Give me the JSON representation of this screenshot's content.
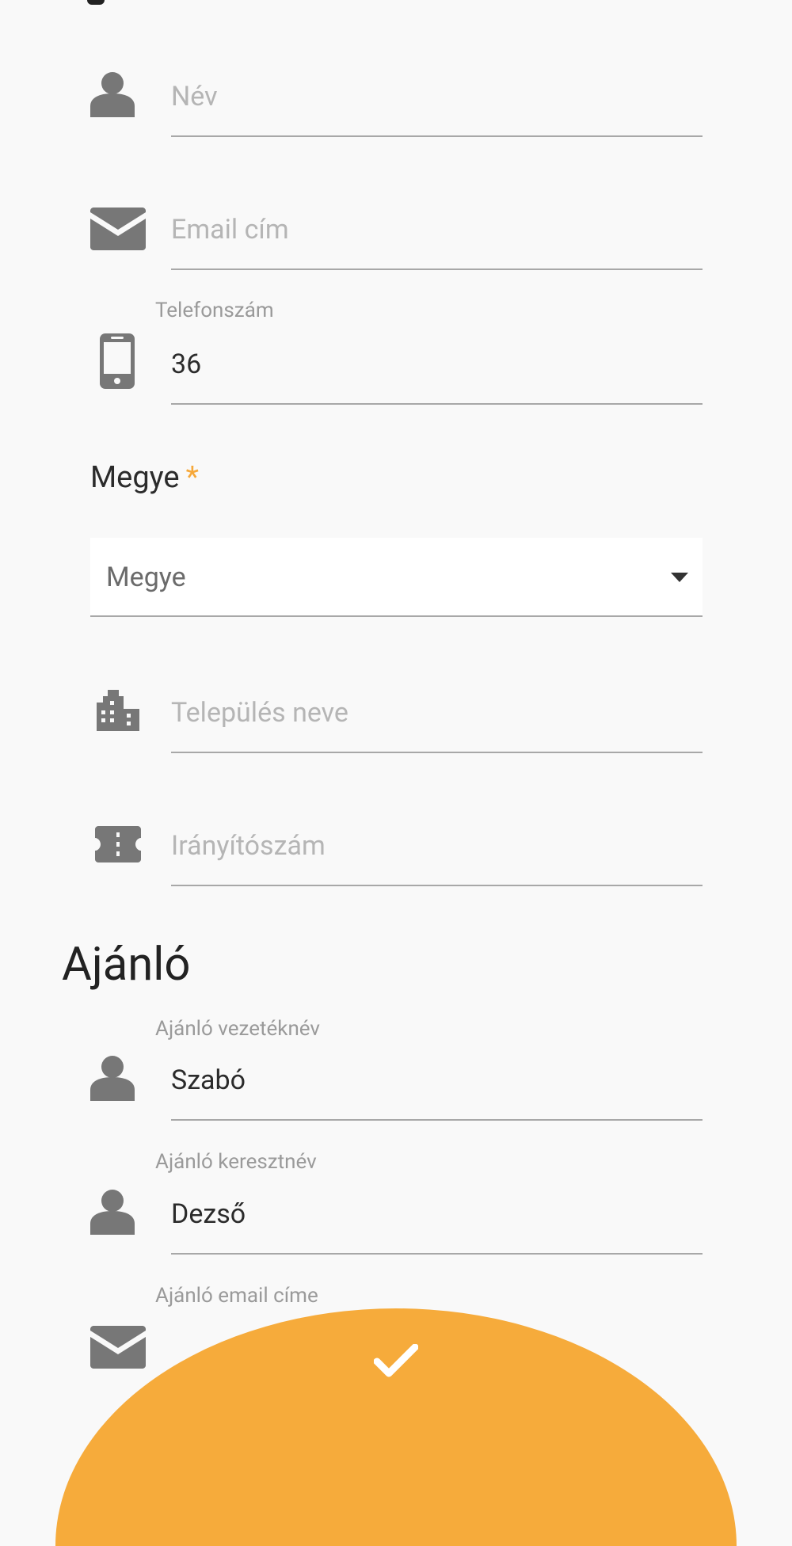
{
  "form": {
    "name": {
      "placeholder": "Név",
      "value": ""
    },
    "email": {
      "placeholder": "Email cím",
      "value": ""
    },
    "phone": {
      "label": "Telefonszám",
      "value": "36"
    },
    "county": {
      "label": "Megye",
      "required_mark": "*",
      "selected": "Megye"
    },
    "city": {
      "placeholder": "Település neve",
      "value": ""
    },
    "zip": {
      "placeholder": "Irányítószám",
      "value": ""
    }
  },
  "referrer": {
    "title": "Ajánló",
    "last_name": {
      "label": "Ajánló vezetéknév",
      "value": "Szabó"
    },
    "first_name": {
      "label": "Ajánló keresztnév",
      "value": "Dezső"
    },
    "email": {
      "label": "Ajánló email címe",
      "value": ""
    }
  },
  "fab": {
    "icon": "check-icon",
    "color": "#f6ab3b"
  },
  "colors": {
    "icon_gray": "#777777",
    "accent": "#f6ab3b",
    "line": "#a8a8a8"
  }
}
